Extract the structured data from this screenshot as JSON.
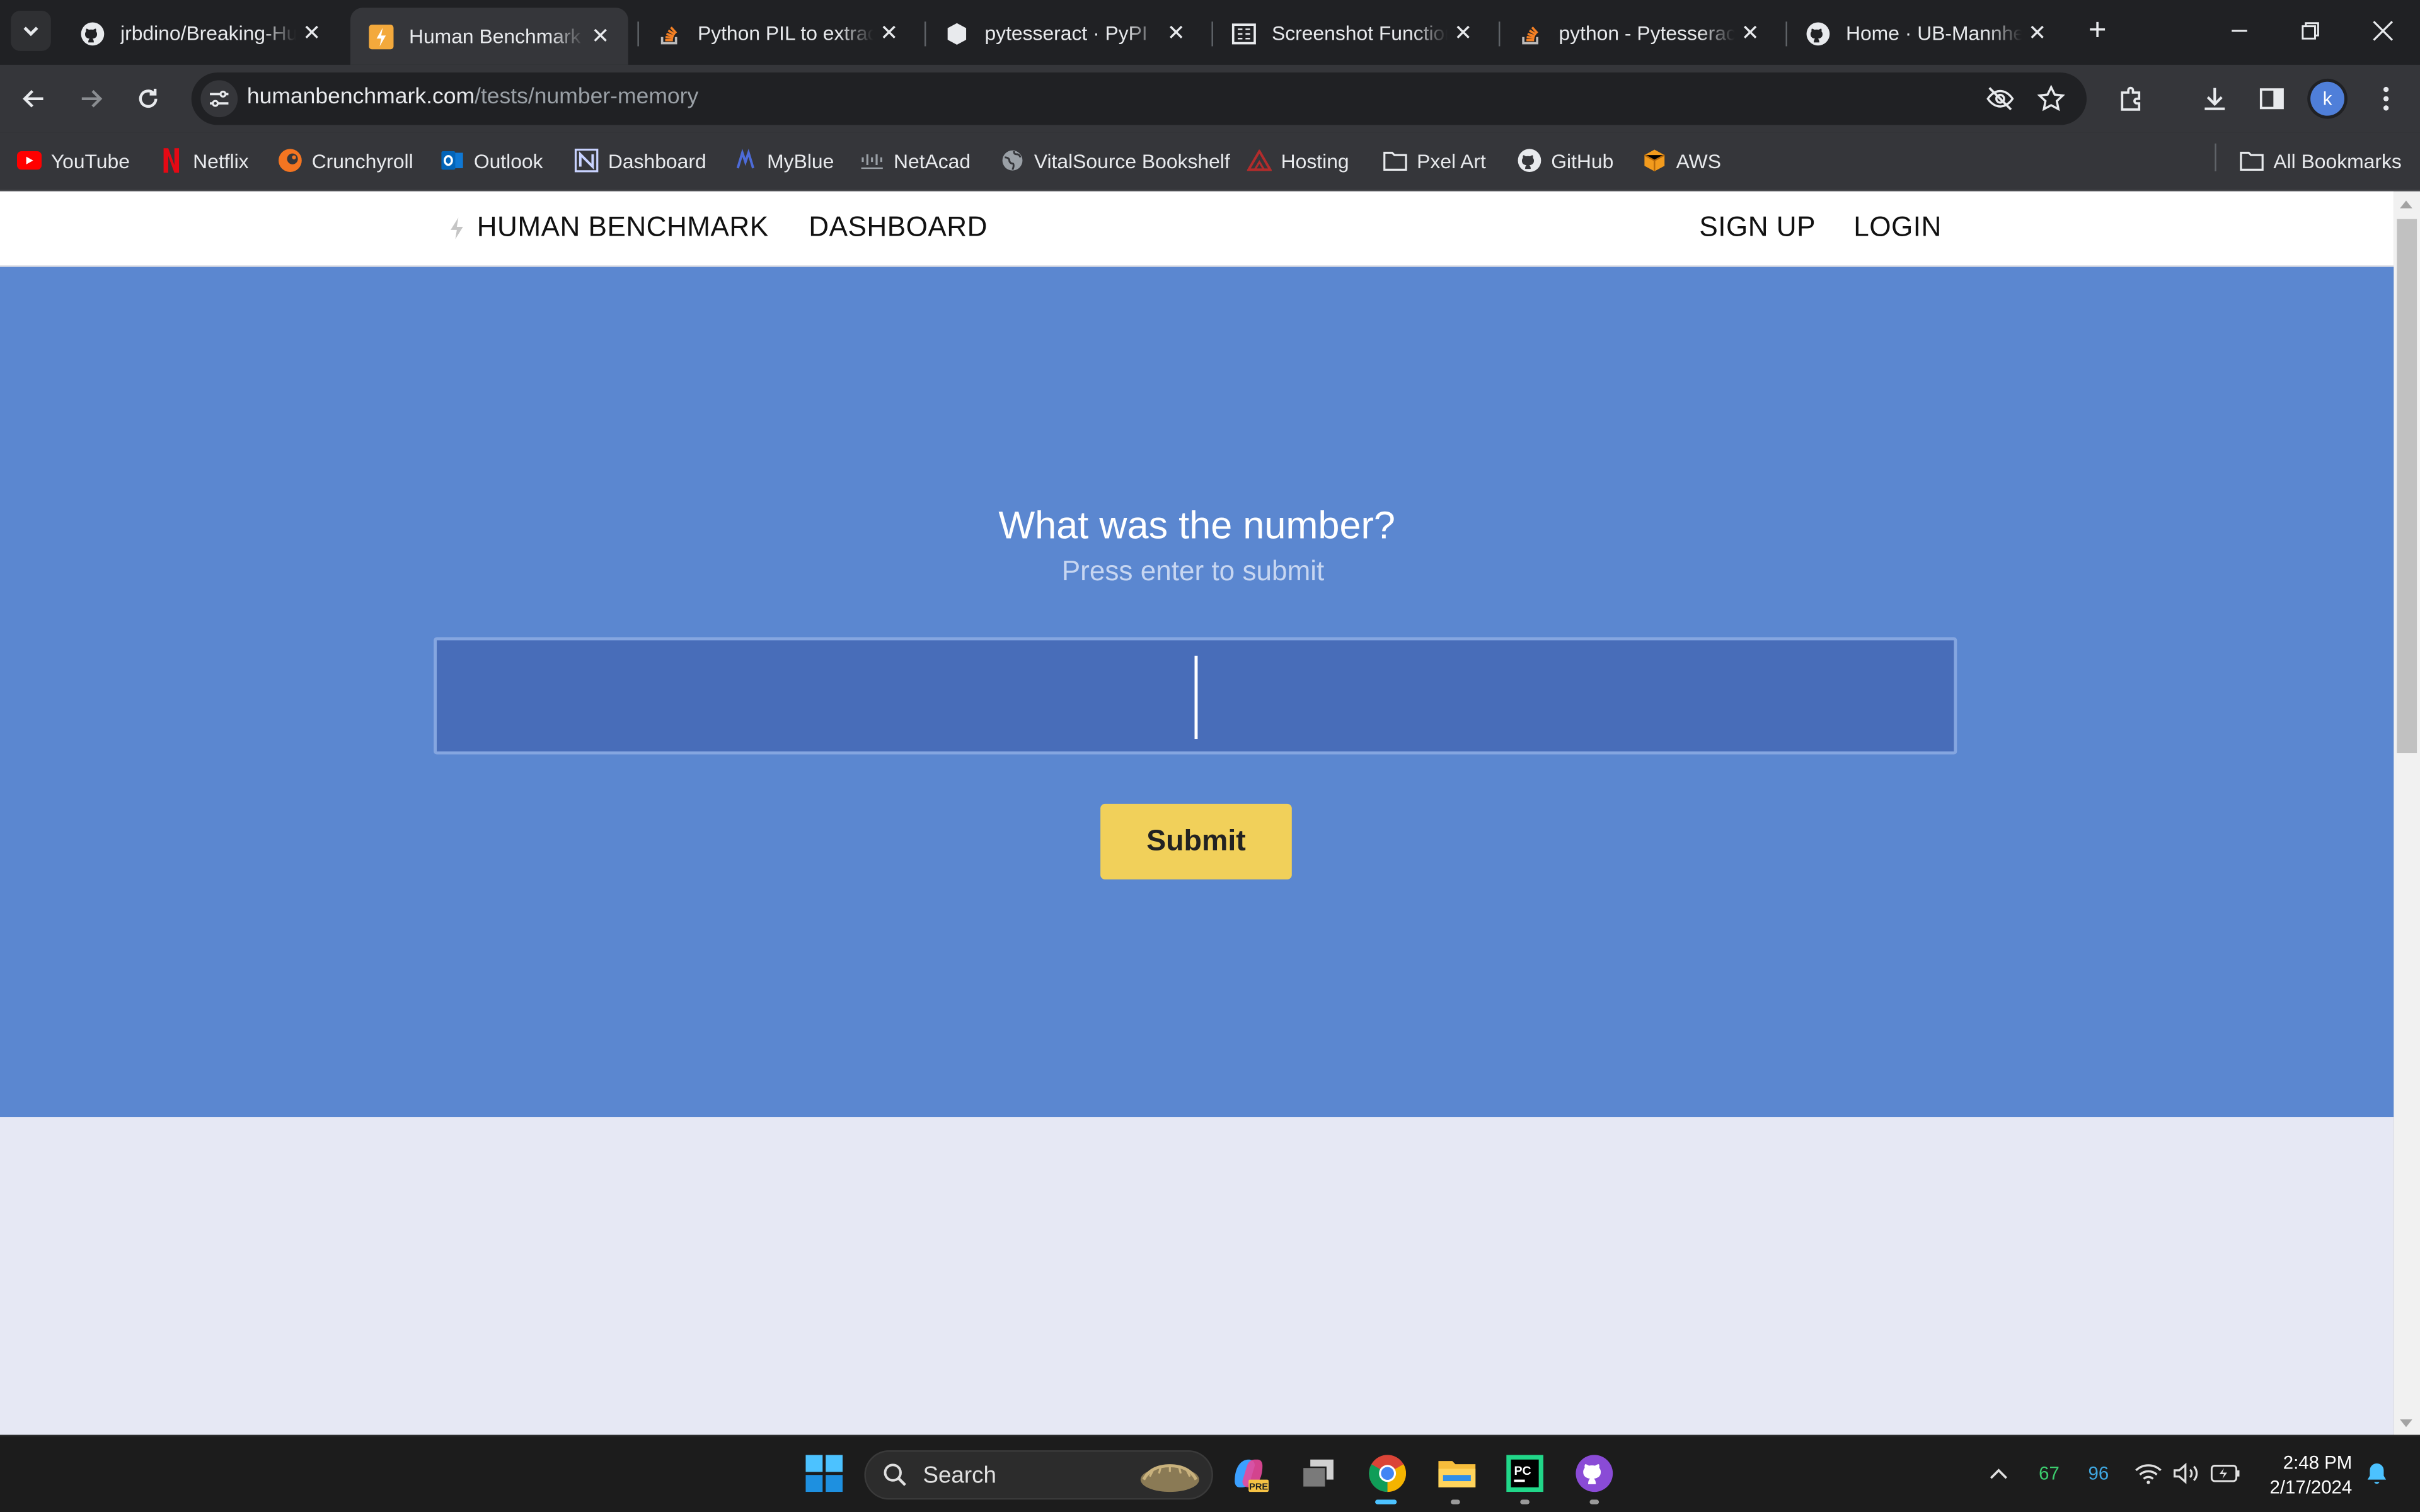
{
  "tabs": [
    {
      "title": "jrbdino/Breaking-Human-Benchmark",
      "icon": "github-icon",
      "active": false
    },
    {
      "title": "Human Benchmark - Number Memory",
      "icon": "human-benchmark-icon",
      "active": true
    },
    {
      "title": "Python PIL to extract number from image",
      "icon": "stackoverflow-icon",
      "active": false
    },
    {
      "title": "pytesseract · PyPI",
      "icon": "pypi-icon",
      "active": false
    },
    {
      "title": "Screenshot Functions",
      "icon": "docs-icon",
      "active": false
    },
    {
      "title": "python - Pytesseract",
      "icon": "stackoverflow-icon",
      "active": false
    },
    {
      "title": "Home · UB-Mannheim/tesseract Wiki",
      "icon": "github-icon",
      "active": false
    }
  ],
  "address_bar": {
    "host": "humanbenchmark.com",
    "path": "/tests/number-memory"
  },
  "profile_initial": "k",
  "bookmarks": [
    {
      "label": "YouTube",
      "icon": "youtube-icon"
    },
    {
      "label": "Netflix",
      "icon": "netflix-icon"
    },
    {
      "label": "Crunchyroll",
      "icon": "crunchyroll-icon"
    },
    {
      "label": "Outlook",
      "icon": "outlook-icon"
    },
    {
      "label": "Dashboard",
      "icon": "dashboard-icon"
    },
    {
      "label": "MyBlue",
      "icon": "myblue-icon"
    },
    {
      "label": "NetAcad",
      "icon": "cisco-icon"
    },
    {
      "label": "VitalSource Bookshelf",
      "icon": "globe-icon"
    },
    {
      "label": "Hosting",
      "icon": "hosting-icon"
    },
    {
      "label": "Pxel Art",
      "icon": "folder-icon"
    },
    {
      "label": "GitHub",
      "icon": "github-icon"
    },
    {
      "label": "AWS",
      "icon": "aws-icon"
    }
  ],
  "all_bookmarks_label": "All Bookmarks",
  "site_nav": {
    "brand": "HUMAN BENCHMARK",
    "dashboard": "DASHBOARD",
    "signup": "SIGN UP",
    "login": "LOGIN"
  },
  "test": {
    "question": "What was the number?",
    "hint": "Press enter to submit",
    "answer_value": "",
    "submit_label": "Submit"
  },
  "taskbar": {
    "search_label": "Search",
    "tray_value_1": "67",
    "tray_value_2": "96",
    "time": "2:48 PM",
    "date": "2/17/2024"
  },
  "colors": {
    "hero_bg": "#5b87d0",
    "input_bg": "#486db9",
    "submit_bg": "#f1d05a",
    "page_bg": "#e6e8f4"
  }
}
